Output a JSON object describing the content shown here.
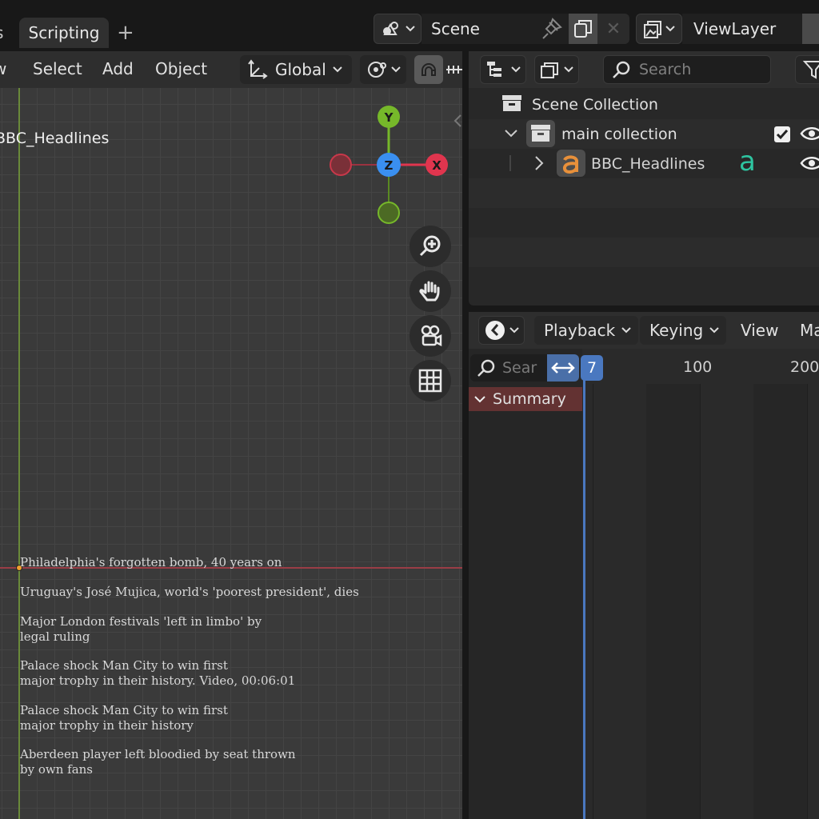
{
  "workspace_tabs": {
    "previous_tab_fragment": "s",
    "active": "Scripting",
    "add_symbol": "+"
  },
  "scene": {
    "name": "Scene",
    "delete_symbol": "✕"
  },
  "view_layer": {
    "name": "ViewLayer"
  },
  "viewport": {
    "menus": {
      "view_fragment": "w",
      "select": "Select",
      "add": "Add",
      "object": "Object"
    },
    "orientation": "Global",
    "object_label": "BBC_Headlines",
    "gizmo": {
      "x": "X",
      "y": "Y",
      "z": "Z"
    },
    "headlines": [
      "Philadelphia's forgotten bomb, 40 years on",
      "Uruguay's José Mujica, world's 'poorest president', dies",
      "Major London festivals 'left in limbo' by\nlegal ruling",
      "Palace shock Man City to win first\nmajor trophy in their history. Video, 00:06:01",
      "Palace shock Man City to win first\nmajor trophy in their history",
      "Aberdeen player left bloodied by seat thrown\nby own fans"
    ],
    "colors": {
      "x_axis": "#e0354e",
      "y_axis": "#76b82a",
      "z_axis": "#3a8ff0"
    }
  },
  "outliner": {
    "search_placeholder": "Search",
    "scene_collection": "Scene Collection",
    "collection": {
      "name": "main collection",
      "checked": true
    },
    "object": {
      "name": "BBC_Headlines",
      "data_icon_glyph": "a"
    }
  },
  "dopesheet": {
    "menus": {
      "playback": "Playback",
      "keying": "Keying",
      "view": "View",
      "marker_fragment": "Ma"
    },
    "search_placeholder": "Sear",
    "summary": "Summary",
    "current_frame": "7",
    "ruler_labels": [
      "100",
      "200"
    ]
  }
}
